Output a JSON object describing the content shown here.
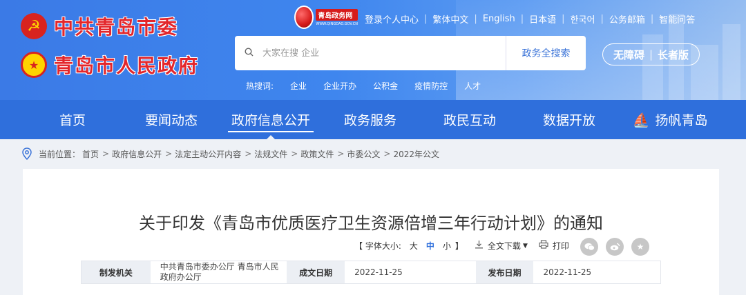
{
  "header": {
    "party_committee": "中共青岛市委",
    "government": "青岛市人民政府",
    "portal_logo": {
      "name": "青岛政务网",
      "url": "WWW.QINGDAO.GOV.CN"
    },
    "top_links": [
      "登录个人中心",
      "繁体中文",
      "English",
      "日本语",
      "한국어",
      "公务邮箱",
      "智能问答"
    ],
    "search": {
      "placeholder": "大家在搜 企业",
      "button": "政务全搜索"
    },
    "accessibility": {
      "barrier_free": "无障碍",
      "elder": "长者版"
    },
    "hot_search": {
      "label": "热搜词:",
      "terms": [
        "企业",
        "企业开办",
        "公积金",
        "疫情防控",
        "人才"
      ]
    }
  },
  "nav": {
    "items": [
      "首页",
      "要闻动态",
      "政府信息公开",
      "政务服务",
      "政民互动",
      "数据开放",
      "扬帆青岛"
    ],
    "active_index": 2
  },
  "breadcrumb": {
    "label": "当前位置：",
    "items": [
      "首页",
      "政府信息公开",
      "法定主动公开内容",
      "法规文件",
      "政策文件",
      "市委公文",
      "2022年公文"
    ]
  },
  "article": {
    "title": "关于印发《青岛市优质医疗卫生资源倍增三年行动计划》的通知",
    "tools": {
      "font_size_label": "【 字体大小:",
      "sizes": [
        "大",
        "中",
        "小"
      ],
      "font_size_close": "】",
      "active_size": "中",
      "download": "全文下载",
      "print": "打印"
    },
    "share_icons": [
      "wechat-icon",
      "weibo-icon",
      "favorite-icon"
    ],
    "meta": {
      "issuer_label": "制发机关",
      "issuer": "中共青岛市委办公厅 青岛市人民政府办公厅",
      "doc_date_label": "成文日期",
      "doc_date": "2022-11-25",
      "pub_date_label": "发布日期",
      "pub_date": "2022-11-25"
    }
  },
  "colors": {
    "nav_bg": "#2f6fdc",
    "header_bg": "#3f86ee",
    "brand_red": "#e3262b",
    "page_bg": "#eef1f6"
  }
}
